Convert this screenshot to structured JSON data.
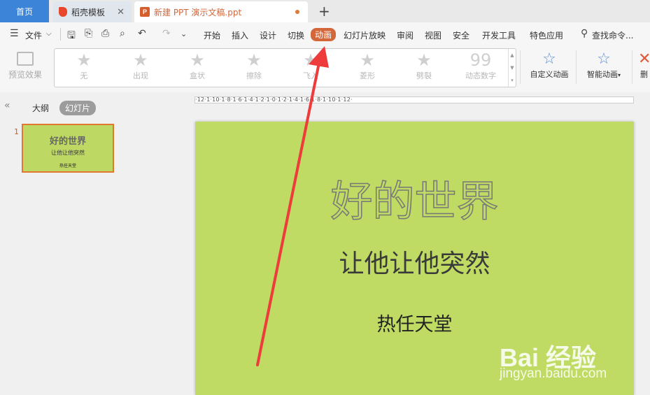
{
  "tabs": {
    "home": "首页",
    "template": "稻壳模板",
    "document": "新建 PPT 演示文稿.ppt",
    "new_tab_symbol": "+",
    "close_symbol": "✕"
  },
  "menu": {
    "file": "文件",
    "items": [
      "开始",
      "插入",
      "设计",
      "切换",
      "动画",
      "幻灯片放映",
      "审阅",
      "视图",
      "安全",
      "开发工具",
      "特色应用"
    ],
    "active": "动画",
    "search": "查找命令..."
  },
  "ribbon": {
    "preview": "预览效果",
    "effects": [
      "无",
      "出现",
      "盒状",
      "擦除",
      "飞入",
      "菱形",
      "劈裂",
      "动态数字"
    ],
    "custom_animation": "自定义动画",
    "smart_animation": "智能动画",
    "delete": "删"
  },
  "left_panel": {
    "outline_tab": "大纲",
    "slides_tab": "幻灯片",
    "collapse_symbol": "«",
    "slide_number": "1"
  },
  "ruler": {
    "label": "·12·1·10·1·8·1·6·1·4·1·2·1·0·1·2·1·4·1·6·1·8·1·10·1·12·"
  },
  "slide": {
    "title": "好的世界",
    "subtitle": "让他让他突然",
    "subtitle2": "热任天堂",
    "background": "#bfdb63"
  },
  "watermark": {
    "brand": "Bai 经验",
    "url": "jingyan.baidu.com"
  },
  "colors": {
    "accent": "#d4673a",
    "home_tab": "#3b84d8",
    "arrow": "#ee3b3b"
  }
}
